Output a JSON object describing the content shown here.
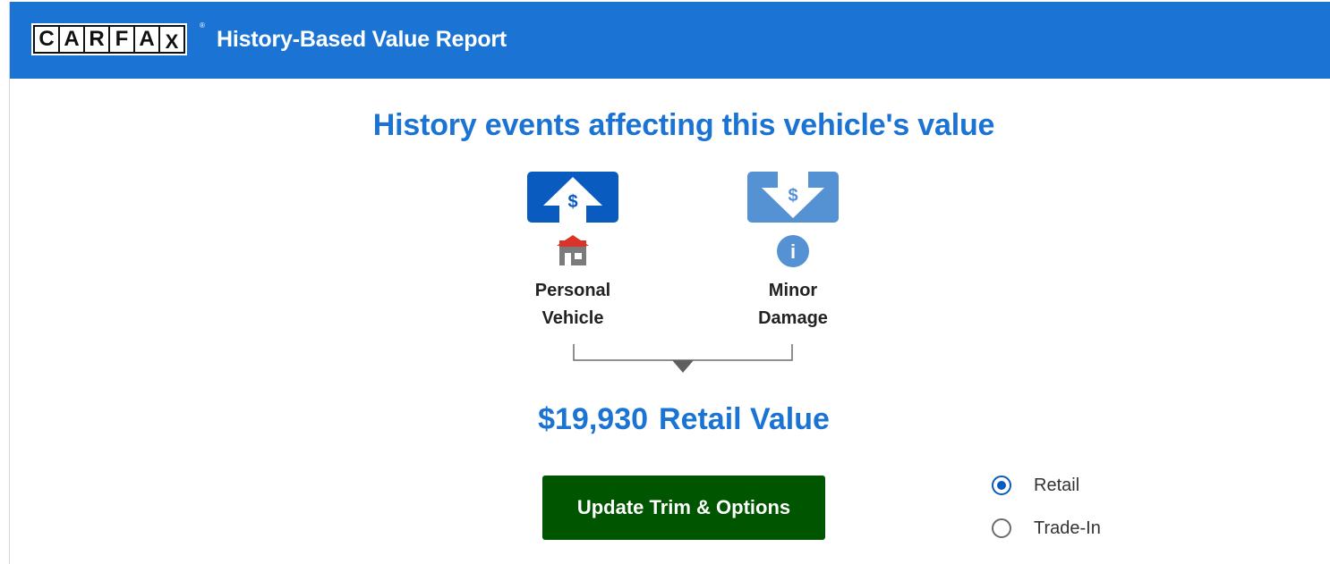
{
  "header": {
    "logo_letters": [
      "C",
      "A",
      "R",
      "F",
      "A",
      "X"
    ],
    "logo_mark": "®",
    "title": "History-Based Value Report",
    "background_color": "#1b74d3"
  },
  "main": {
    "title": "History events affecting this vehicle's value",
    "events": [
      {
        "box_icon": "dollar-up-arrow-icon",
        "box_glyph": "$",
        "box_color": "#0a5bbf",
        "icon": "house-icon",
        "label_line1": "Personal",
        "label_line2": "Vehicle"
      },
      {
        "box_icon": "dollar-down-arrow-icon",
        "box_glyph": "$",
        "box_color": "#5592d4",
        "icon": "info-icon",
        "icon_glyph": "i",
        "label_line1": "Minor",
        "label_line2": "Damage"
      }
    ],
    "value_amount": "$19,930",
    "value_label": "Retail Value",
    "update_button": "Update Trim & Options",
    "update_button_color": "#005600",
    "value_type_options": [
      {
        "label": "Retail",
        "selected": true
      },
      {
        "label": "Trade-In",
        "selected": false
      }
    ]
  }
}
